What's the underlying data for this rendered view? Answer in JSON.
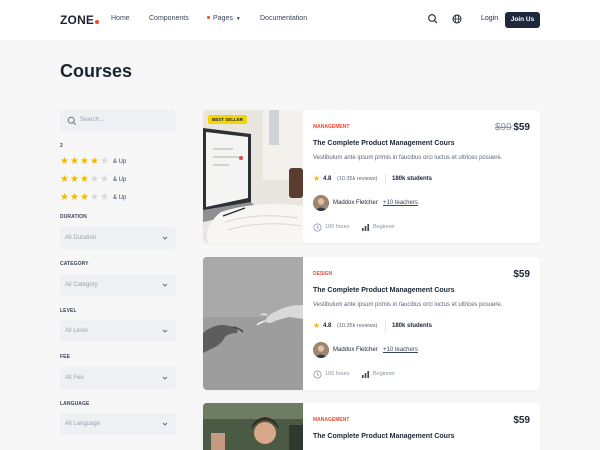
{
  "nav": {
    "logo": "ZONE",
    "links": [
      {
        "label": "Home"
      },
      {
        "label": "Components"
      },
      {
        "label": "Pages"
      },
      {
        "label": "Documentation"
      }
    ],
    "login": "Login",
    "join": "Join Us"
  },
  "page_title": "Courses",
  "sidebar": {
    "search_placeholder": "Search...",
    "rating_label": "2",
    "ratings": [
      {
        "stars": 4,
        "label": "& Up"
      },
      {
        "stars": 3,
        "label": "& Up"
      },
      {
        "stars": 3,
        "label": "& Up"
      }
    ],
    "filters": [
      {
        "label": "DURATION",
        "value": "All Duration"
      },
      {
        "label": "CATEGORY",
        "value": "All Category"
      },
      {
        "label": "LEVEL",
        "value": "All Level"
      },
      {
        "label": "FEE",
        "value": "All Fee"
      },
      {
        "label": "LANGUAGE",
        "value": "All Language"
      }
    ]
  },
  "courses": [
    {
      "badge": "BEST SELLER",
      "category": "MANAGEMENT",
      "price_old": "$99",
      "price": "$59",
      "title": "The Complete Product Management Cours",
      "description": "Vestibulum ante ipsum primis in faucibus orci luctus et ultrices posuere.",
      "rating": "4.8",
      "reviews": "(10.35k reviews)",
      "students": "180k students",
      "instructor": "Maddox Fletcher",
      "teachers": "+10 teachers",
      "hours": "100 hours",
      "level": "Beginner"
    },
    {
      "category": "DESIGN",
      "price": "$59",
      "title": "The Complete Product Management Cours",
      "description": "Vestibulum ante ipsum primis in faucibus orci luctus et ultrices posuere.",
      "rating": "4.8",
      "reviews": "(10.35k reviews)",
      "students": "180k students",
      "instructor": "Maddox Fletcher",
      "teachers": "+10 teachers",
      "hours": "100 hours",
      "level": "Beginner"
    },
    {
      "category": "MANAGEMENT",
      "price": "$59",
      "title": "The Complete Product Management Cours"
    }
  ],
  "colors": {
    "accent": "#f0472c",
    "star": "#f5b800",
    "dark": "#1e2a3b"
  }
}
